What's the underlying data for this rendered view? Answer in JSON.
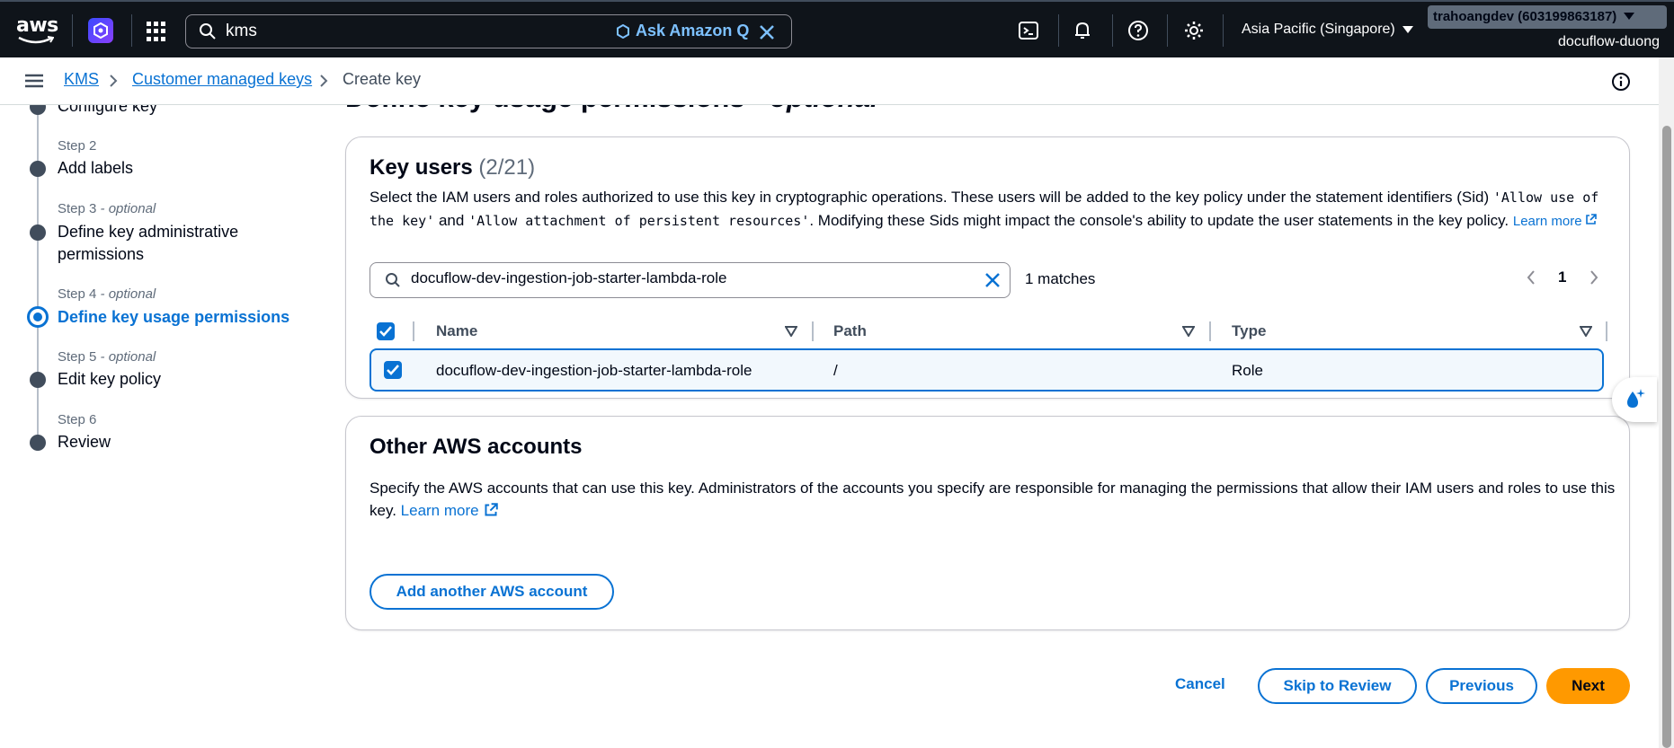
{
  "topbar": {
    "logo_text": "aws",
    "search_value": "kms",
    "ask_q_label": "Ask Amazon Q",
    "region_label": "Asia Pacific (Singapore)",
    "account_label": "trahoangdev (603199863187)",
    "user_label": "docuflow-duong"
  },
  "breadcrumb": {
    "items": [
      "KMS",
      "Customer managed keys",
      "Create key"
    ]
  },
  "steps": [
    {
      "num": "",
      "optional": "",
      "title": "Configure key"
    },
    {
      "num": "Step 2",
      "optional": "",
      "title": "Add labels"
    },
    {
      "num": "Step 3",
      "optional": " - optional",
      "title": "Define key administrative permissions"
    },
    {
      "num": "Step 4",
      "optional": " - optional",
      "title": "Define key usage permissions"
    },
    {
      "num": "Step 5",
      "optional": " - optional",
      "title": "Edit key policy"
    },
    {
      "num": "Step 6",
      "optional": "",
      "title": "Review"
    }
  ],
  "heading": {
    "main": "Define key usage permissions",
    "optional": " - optional"
  },
  "key_users": {
    "title": "Key users",
    "count": "(2/21)",
    "desc_part1": "Select the IAM users and roles authorized to use this key in cryptographic operations. These users will be added to the key policy under the statement identifiers (Sid) ",
    "sid1": "'Allow use of the key'",
    "desc_and": " and ",
    "sid2": "'Allow attachment of persistent resources'",
    "desc_part2": ". Modifying these Sids might impact the console's ability to update the user statements in the key policy.",
    "learn_more": "Learn more",
    "filter_value": "docuflow-dev-ingestion-job-starter-lambda-role",
    "matches": "1 matches",
    "page": "1",
    "columns": [
      "Name",
      "Path",
      "Type"
    ],
    "rows": [
      {
        "name": "docuflow-dev-ingestion-job-starter-lambda-role",
        "path": "/",
        "type": "Role"
      }
    ]
  },
  "other_accounts": {
    "title": "Other AWS accounts",
    "desc": "Specify the AWS accounts that can use this key. Administrators of the accounts you specify are responsible for managing the permissions that allow their IAM users and roles to use this key.",
    "learn_more": "Learn more",
    "add_button": "Add another AWS account"
  },
  "footer": {
    "cancel": "Cancel",
    "skip": "Skip to Review",
    "previous": "Previous",
    "next": "Next"
  },
  "colors": {
    "accent": "#0972d3",
    "primary_button": "#ff9900",
    "topbar": "#0f141a"
  }
}
